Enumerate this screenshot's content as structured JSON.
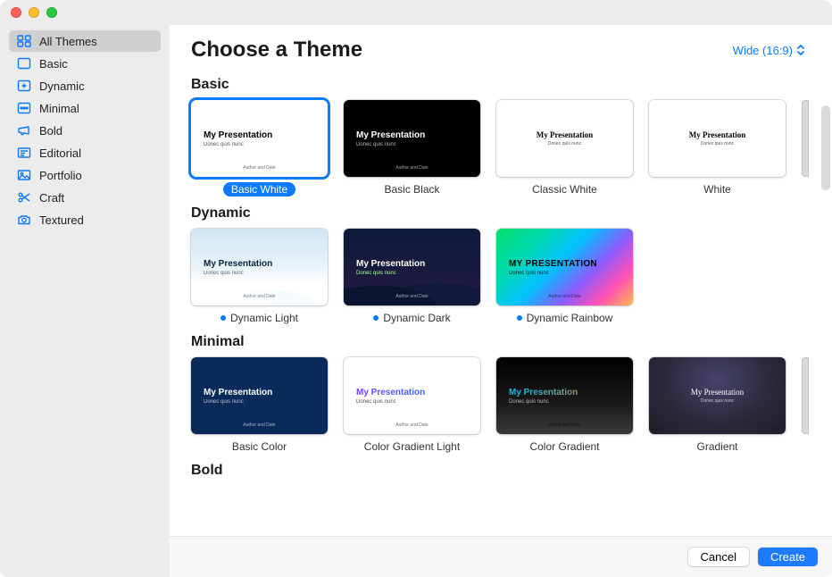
{
  "header": {
    "title": "Choose a Theme",
    "aspect": "Wide (16:9)"
  },
  "sidebar": {
    "items": [
      {
        "label": "All Themes",
        "icon": "grid-all"
      },
      {
        "label": "Basic",
        "icon": "square"
      },
      {
        "label": "Dynamic",
        "icon": "square-plus"
      },
      {
        "label": "Minimal",
        "icon": "dots"
      },
      {
        "label": "Bold",
        "icon": "megaphone"
      },
      {
        "label": "Editorial",
        "icon": "news"
      },
      {
        "label": "Portfolio",
        "icon": "photo"
      },
      {
        "label": "Craft",
        "icon": "scissors"
      },
      {
        "label": "Textured",
        "icon": "camera"
      }
    ],
    "selectedIndex": 0
  },
  "sections": [
    {
      "name": "Basic",
      "themes": [
        {
          "label": "Basic White",
          "style": "white",
          "selected": true,
          "dynamic": false
        },
        {
          "label": "Basic Black",
          "style": "black",
          "selected": false,
          "dynamic": false
        },
        {
          "label": "Classic White",
          "style": "classic",
          "selected": false,
          "dynamic": false
        },
        {
          "label": "White",
          "style": "white2",
          "selected": false,
          "dynamic": false
        }
      ],
      "more": true
    },
    {
      "name": "Dynamic",
      "themes": [
        {
          "label": "Dynamic Light",
          "style": "dyn-light",
          "selected": false,
          "dynamic": true
        },
        {
          "label": "Dynamic Dark",
          "style": "dyn-dark",
          "selected": false,
          "dynamic": true
        },
        {
          "label": "Dynamic Rainbow",
          "style": "rainbow",
          "selected": false,
          "dynamic": true
        }
      ],
      "more": false
    },
    {
      "name": "Minimal",
      "themes": [
        {
          "label": "Basic Color",
          "style": "basic-color",
          "selected": false,
          "dynamic": false
        },
        {
          "label": "Color Gradient Light",
          "style": "grad-light",
          "selected": false,
          "dynamic": false
        },
        {
          "label": "Color Gradient",
          "style": "grad",
          "selected": false,
          "dynamic": false
        },
        {
          "label": "Gradient",
          "style": "gradient2",
          "selected": false,
          "dynamic": false
        }
      ],
      "more": true
    },
    {
      "name": "Bold",
      "themes": []
    }
  ],
  "thumbText": {
    "title": "My Presentation",
    "titleUpper": "MY PRESENTATION",
    "sub": "Donec quis nunc",
    "auth": "Author and Date"
  },
  "footer": {
    "cancel": "Cancel",
    "create": "Create"
  }
}
